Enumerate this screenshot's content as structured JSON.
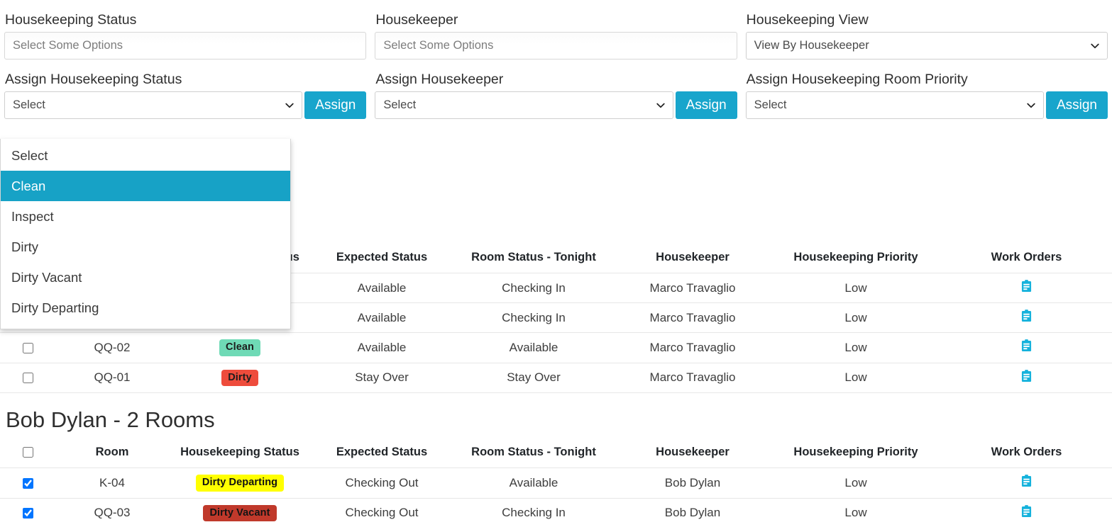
{
  "filters": {
    "housekeeping_status": {
      "label": "Housekeeping Status",
      "placeholder": "Select Some Options",
      "value": ""
    },
    "housekeeper": {
      "label": "Housekeeper",
      "placeholder": "Select Some Options",
      "value": ""
    },
    "housekeeping_view": {
      "label": "Housekeeping View",
      "value": "View By Housekeeper"
    }
  },
  "assign": {
    "status": {
      "label": "Assign Housekeeping Status",
      "value": "Select",
      "button": "Assign",
      "open": true,
      "options": [
        "Select",
        "Clean",
        "Inspect",
        "Dirty",
        "Dirty Vacant",
        "Dirty Departing"
      ],
      "highlighted": "Clean"
    },
    "housekeeper": {
      "label": "Assign Housekeeper",
      "value": "Select",
      "button": "Assign"
    },
    "priority": {
      "label": "Assign Housekeeping Room Priority",
      "value": "Select",
      "button": "Assign"
    }
  },
  "columns": [
    "",
    "Room",
    "Housekeeping Status",
    "Expected Status",
    "Room Status - Tonight",
    "Housekeeper",
    "Housekeeping Priority",
    "Work Orders"
  ],
  "groups": [
    {
      "title": "",
      "rows": [
        {
          "checked": false,
          "room": "",
          "status": "",
          "status_class": "hidden",
          "expected": "Available",
          "tonight": "Checking In",
          "housekeeper": "Marco Travaglio",
          "priority": "Low",
          "work_order": "clipboard-icon"
        },
        {
          "checked": false,
          "room": "",
          "status": "",
          "status_class": "hidden",
          "expected": "Available",
          "tonight": "Checking In",
          "housekeeper": "Marco Travaglio",
          "priority": "Low",
          "work_order": "clipboard-icon"
        },
        {
          "checked": false,
          "room": "QQ-02",
          "status": "Clean",
          "status_class": "b-clean",
          "expected": "Available",
          "tonight": "Available",
          "housekeeper": "Marco Travaglio",
          "priority": "Low",
          "work_order": "clipboard-icon"
        },
        {
          "checked": false,
          "room": "QQ-01",
          "status": "Dirty",
          "status_class": "b-dirty",
          "expected": "Stay Over",
          "tonight": "Stay Over",
          "housekeeper": "Marco Travaglio",
          "priority": "Low",
          "work_order": "clipboard-icon"
        }
      ]
    },
    {
      "title": "Bob Dylan - 2 Rooms",
      "rows": [
        {
          "checked": true,
          "room": "K-04",
          "status": "Dirty Departing",
          "status_class": "b-dd",
          "expected": "Checking Out",
          "tonight": "Available",
          "housekeeper": "Bob Dylan",
          "priority": "Low",
          "work_order": "clipboard-icon"
        },
        {
          "checked": true,
          "room": "QQ-03",
          "status": "Dirty Vacant",
          "status_class": "b-dv",
          "expected": "Checking Out",
          "tonight": "Checking In",
          "housekeeper": "Bob Dylan",
          "priority": "Low",
          "work_order": "clipboard-icon"
        }
      ]
    }
  ],
  "colors": {
    "accent": "#18A5CC",
    "dropdown_highlight": "#17A2C6",
    "badge_clean": "#6FDAB6",
    "badge_dirty": "#EE4C3C",
    "badge_dirty_departing": "#FFFF00",
    "badge_dirty_vacant": "#C0392B",
    "work_order_icon": "#15B2DC"
  }
}
